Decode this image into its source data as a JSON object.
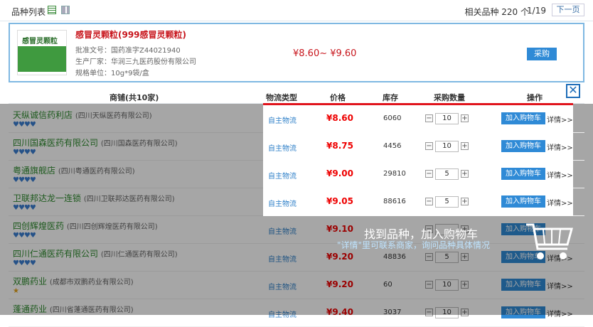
{
  "topbar": {
    "title": "品种列表",
    "count": "相关品种 220 个",
    "page": "1/19",
    "next": "下一页"
  },
  "product": {
    "image_label": "感冒灵颗粒",
    "name": "感冒灵颗粒(999感冒灵颗粒)",
    "approval": "批准文号：国药准字Z44021940",
    "maker": "生产厂家：华润三九医药股份有限公司",
    "spec": "规格单位：10g*9袋/盒",
    "price_range": "¥8.60~ ¥9.60",
    "buy": "采购"
  },
  "headers": {
    "shop": "商铺(共10家)",
    "logistics": "物流类型",
    "price": "价格",
    "stock": "库存",
    "qty": "采购数量",
    "op": "操作"
  },
  "rows": [
    {
      "shop": "天纵诚信药利店",
      "company": "(四川天纵医药有限公司)",
      "hearts": "♥♥♥♥",
      "logistics": "自主物流",
      "price": "¥8.60",
      "stock": "6060",
      "qty": "10",
      "cart": "加入购物车",
      "detail": "详情>>"
    },
    {
      "shop": "四川国森医药有限公司",
      "company": "(四川国森医药有限公司)",
      "hearts": "♥♥♥♥",
      "logistics": "自主物流",
      "price": "¥8.75",
      "stock": "4456",
      "qty": "10",
      "cart": "加入购物车",
      "detail": "详情>>"
    },
    {
      "shop": "粤通旗舰店",
      "company": "(四川粤通医药有限公司)",
      "hearts": "♥♥♥♥",
      "logistics": "自主物流",
      "price": "¥9.00",
      "stock": "29810",
      "qty": "5",
      "cart": "加入购物车",
      "detail": "详情>>"
    },
    {
      "shop": "卫联邦达龙一连锁",
      "company": "(四川卫联邦达医药有限公司)",
      "hearts": "♥♥♥♥",
      "logistics": "自主物流",
      "price": "¥9.05",
      "stock": "88616",
      "qty": "5",
      "cart": "加入购物车",
      "detail": "详情>>"
    },
    {
      "shop": "四创辉煌医药",
      "company": "(四川四创辉煌医药有限公司)",
      "hearts": "♥♥♥♥",
      "logistics": "自主物流",
      "price": "¥9.10",
      "stock": "",
      "qty": "",
      "cart": "加入购物车",
      "detail": ""
    },
    {
      "shop": "四川仁通医药有限公司",
      "company": "(四川仁通医药有限公司)",
      "hearts": "♥♥♥♥",
      "logistics": "自主物流",
      "price": "¥9.20",
      "stock": "48836",
      "qty": "5",
      "cart": "加入购物车",
      "detail": "详情>>"
    },
    {
      "shop": "双鹏药业",
      "company": "(成都市双鹏药业有限公司)",
      "hearts": "★",
      "logistics": "自主物流",
      "price": "¥9.20",
      "stock": "60",
      "qty": "10",
      "cart": "加入购物车",
      "detail": "详情>>"
    },
    {
      "shop": "蓬通药业",
      "company": "(四川省蓬通医药有限公司)",
      "hearts": "",
      "logistics": "自主物流",
      "price": "¥9.40",
      "stock": "3037",
      "qty": "10",
      "cart": "加入购物车",
      "detail": "详情>>"
    }
  ],
  "callout": {
    "line1": "找到品种，加入购物车",
    "line2": "\"详情\"里可联系商家，询问品种具体情况"
  },
  "colors": {
    "accent": "#2f8ad6",
    "price": "#e00000",
    "highlight": "#e0141c"
  }
}
